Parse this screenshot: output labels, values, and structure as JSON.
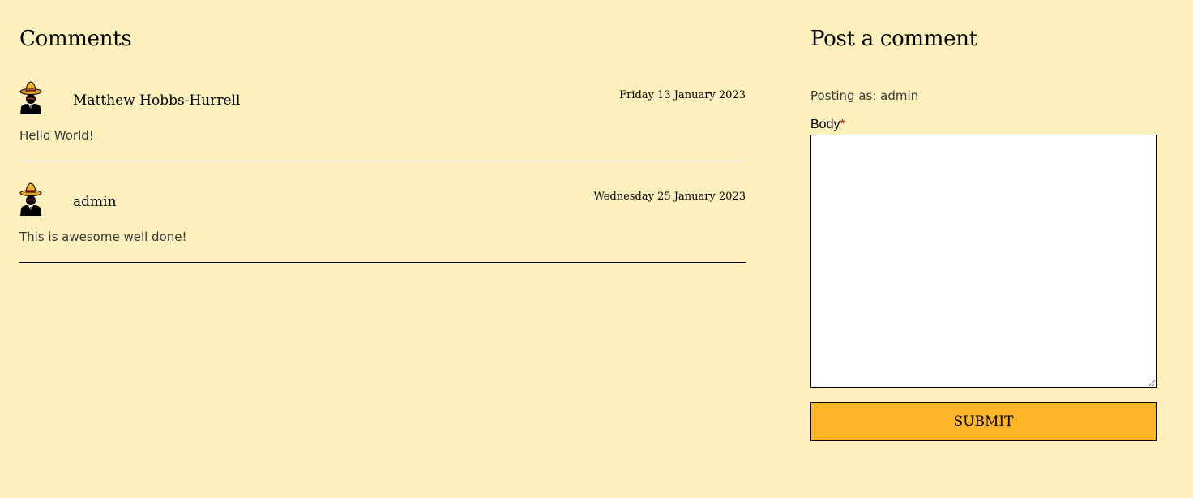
{
  "comments_section": {
    "title": "Comments",
    "items": [
      {
        "author": "Matthew Hobbs-Hurrell",
        "date": "Friday 13 January 2023",
        "body": "Hello World!",
        "avatar_icon": "sombrero-man-icon"
      },
      {
        "author": "admin",
        "date": "Wednesday 25 January 2023",
        "body": "This is awesome well done!",
        "avatar_icon": "sombrero-man-icon"
      }
    ]
  },
  "post_form": {
    "title": "Post a comment",
    "posting_as": "Posting as: admin",
    "body_label": "Body",
    "required_marker": "*",
    "body_value": "",
    "submit_label": "SUBMIT"
  },
  "colors": {
    "background": "#fdf0bd",
    "submit_button": "#fcb525",
    "required_marker": "#e00000",
    "divider": "#000000"
  }
}
